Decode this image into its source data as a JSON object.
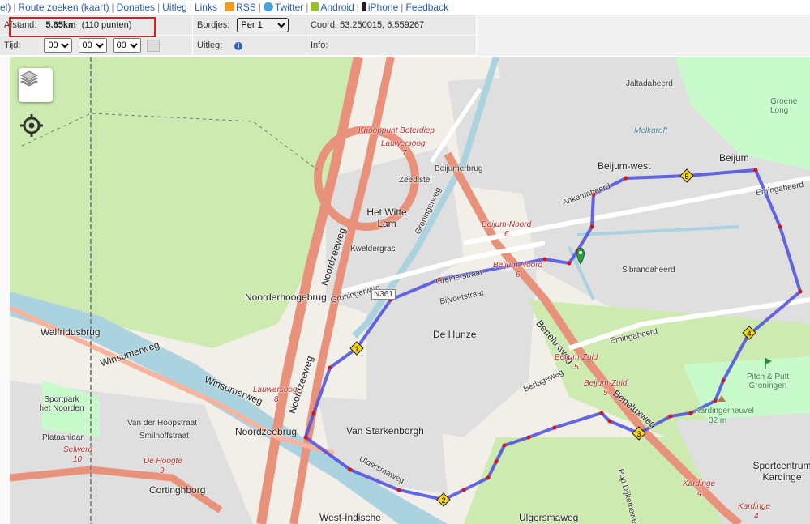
{
  "nav": {
    "items": [
      {
        "label": "el)"
      },
      {
        "label": "Route zoeken (kaart)"
      },
      {
        "label": "Donaties"
      },
      {
        "label": "Uitleg"
      },
      {
        "label": "Links"
      },
      {
        "label": "RSS"
      },
      {
        "label": "Twitter"
      },
      {
        "label": "Android"
      },
      {
        "label": "iPhone"
      },
      {
        "label": "Feedback"
      }
    ]
  },
  "info": {
    "distance_label": "Afstand:",
    "distance_value": "5.65km",
    "distance_points": "(110 punten)",
    "time_label": "Tijd:",
    "time_hours": "00",
    "time_minutes": "00",
    "time_seconds": "00",
    "signs_label": "Bordjes:",
    "signs_value": "Per 1",
    "explain_label": "Uitleg:",
    "coord_label": "Coord:",
    "coord_value": "53.250015, 6.559267",
    "info_label": "Info:"
  },
  "map": {
    "labels": {
      "knooppunt": "Knooppunt Boterdiep",
      "lauwersoog7": "Lauwersoog",
      "lauwersoog7_num": "7",
      "beijumerbrug": "Beijumerbrug",
      "beijum_west": "Beijum-west",
      "beijum": "Beijum",
      "groene_long": "Groene Long",
      "jaltadaheerd": "Jaltadaheerd",
      "ankemaheerd": "Ankemaheerd",
      "emingaheerd": "Emingaheerd",
      "emingaheerd2": "Emingaheerd",
      "melkgroft": "Melkgroft",
      "sibrandaheerd": "Sibrandaheerd",
      "beijum_noord": "Beijum-Noord",
      "beijum_noord_num": "6",
      "beijum_noord2": "Beijum-Noord",
      "beijum_noord2_num": "6",
      "het_witte_lam": "Het Witte Lam",
      "kweldergras": "Kweldergras",
      "zeedistel": "Zeedistel",
      "groningerweg": "Groningerweg",
      "groningerweg2": "Groningerweg",
      "noordzeeweg": "Noordzeeweg",
      "noordzeeweg2": "Noordzeeweg",
      "noorderhoogebrug": "Noorderhoogebrug",
      "n361": "N361",
      "greinerstraat": "Greinerstraat",
      "bijvoetstraat": "Bijvoetstraat",
      "de_hunze": "De Hunze",
      "beneluxweg": "Beneluxweg",
      "beneluxweg2": "Beneluxweg",
      "beijum_zuid": "Beijum-Zuid",
      "beijum_zuid_num": "5",
      "beijum_zuid2": "Beijum-Zuid",
      "beijum_zuid2_num": "5",
      "walfridusbrug": "Walfridusbrug",
      "winsumerweg": "Winsumerweg",
      "winsumerweg2": "Winsumerweg",
      "lauwersoog8": "Lauwersoog",
      "lauwersoog8_num": "8",
      "noordzeebrug": "Noordzeebrug",
      "van_starkenborgh": "Van Starkenborgh",
      "sportpark": "Sportpark het Noorden",
      "selwerd": "Selwerd",
      "selwerd_num": "10",
      "de_hoogte": "De Hoogte",
      "de_hoogte_num": "9",
      "cortinghborg": "Cortinghborg",
      "west_indische": "West-Indische",
      "van_der_hoopstraat": "Van der Hoopstraat",
      "smilnoffstraat": "Smilnoffstraat",
      "plataanlaan": "Plataanlaan",
      "ulgersmaweg": "Ulgersmaweg",
      "ulgersmaweg2": "Ulgersmaweg",
      "pitch_putt": "Pitch & Putt Groningen",
      "kardingerheuvel": "Kardingerheuvel",
      "kardingerheuvel_num": "32 m",
      "sportcentrum": "Sportcentrum Kardinge",
      "kardinge": "Kardinge",
      "kardinge_num": "4",
      "kardinge2": "Kardinge",
      "kardinge2_num": "4",
      "berlageweg": "Berlageweg",
      "pop_dijkemaweg": "Pop Dijkemaweg"
    },
    "route_markers": [
      "1",
      "2",
      "3",
      "4",
      "5"
    ],
    "colors": {
      "route": "#4a4ee0",
      "route_points": "#e01010",
      "motorway": "#e8927c",
      "water": "#aad3df",
      "park": "#c8facc",
      "grass": "#cdebb0",
      "residential": "#e0dfdf",
      "highlight_box": "#d71f1f",
      "link": "#2a5db0"
    }
  }
}
